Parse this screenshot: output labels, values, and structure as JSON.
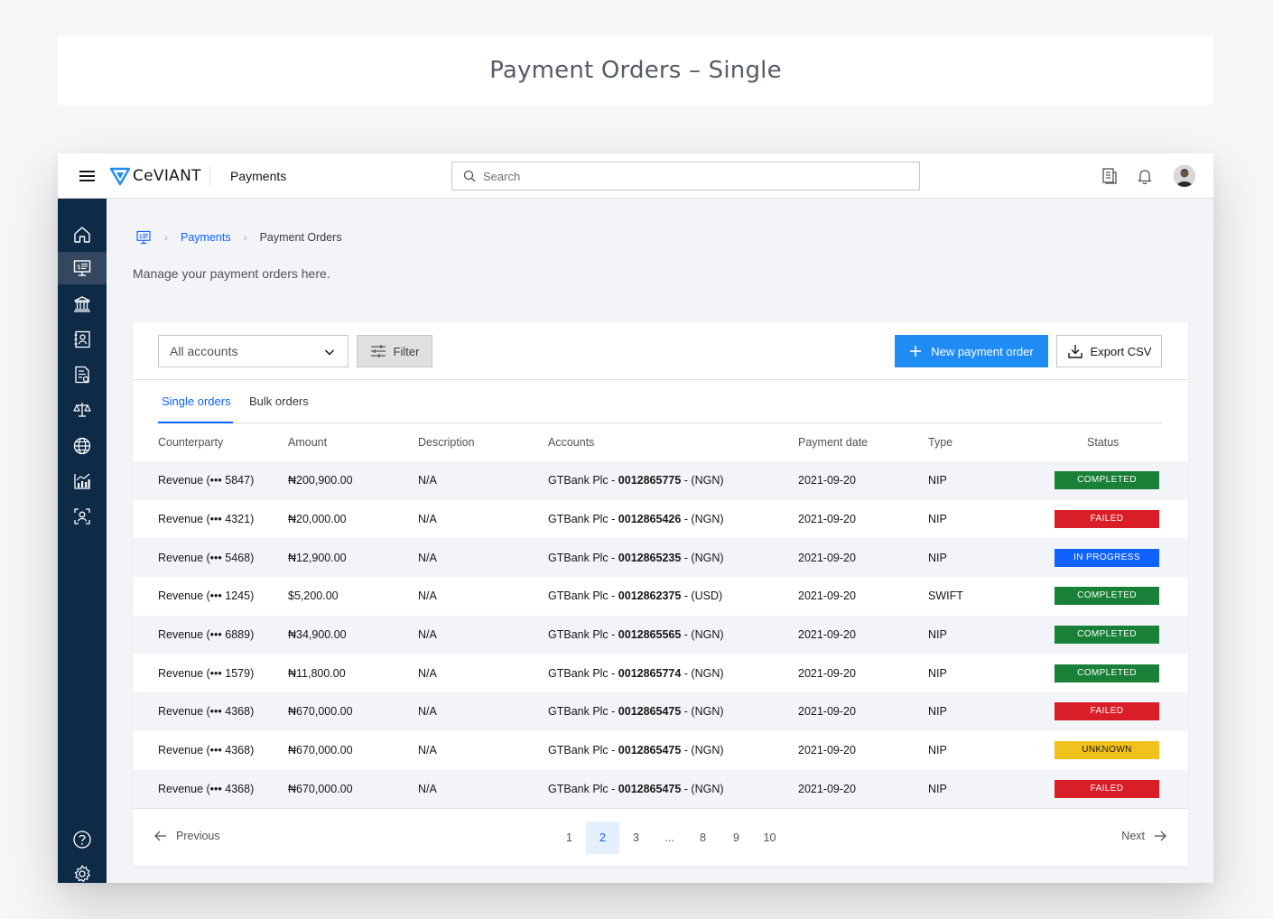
{
  "banner": {
    "title": "Payment Orders – Single"
  },
  "header": {
    "brand": "CeVIANT",
    "section": "Payments",
    "search_placeholder": "Search"
  },
  "sidebar": {
    "items": [
      {
        "icon": "home-icon",
        "active": false
      },
      {
        "icon": "payments-icon",
        "active": true
      },
      {
        "icon": "bank-icon",
        "active": false
      },
      {
        "icon": "contacts-icon",
        "active": false
      },
      {
        "icon": "invoice-icon",
        "active": false
      },
      {
        "icon": "scale-icon",
        "active": false
      },
      {
        "icon": "globe-icon",
        "active": false
      },
      {
        "icon": "analytics-icon",
        "active": false
      },
      {
        "icon": "user-scan-icon",
        "active": false
      }
    ],
    "bottom": [
      "help-icon",
      "settings-icon"
    ]
  },
  "breadcrumb": {
    "link": "Payments",
    "current": "Payment Orders"
  },
  "subtitle": "Manage your payment orders here.",
  "toolbar": {
    "account_select": "All accounts",
    "filter_label": "Filter",
    "new_label": "New payment order",
    "export_label": "Export CSV"
  },
  "tabs": [
    {
      "label": "Single orders",
      "active": true
    },
    {
      "label": "Bulk orders",
      "active": false
    }
  ],
  "table": {
    "columns": [
      "Counterparty",
      "Amount",
      "Description",
      "Accounts",
      "Payment date",
      "Type",
      "Status"
    ],
    "rows": [
      {
        "counterparty": "Revenue (••• 5847)",
        "amount": "₦200,900.00",
        "description": "N/A",
        "bank": "GTBank Plc - ",
        "account": "0012865775",
        "currency": " - (NGN)",
        "date": "2021-09-20",
        "type": "NIP",
        "status": "COMPLETED"
      },
      {
        "counterparty": "Revenue (••• 4321)",
        "amount": "₦20,000.00",
        "description": "N/A",
        "bank": "GTBank Plc - ",
        "account": "0012865426",
        "currency": " - (NGN)",
        "date": "2021-09-20",
        "type": "NIP",
        "status": "FAILED"
      },
      {
        "counterparty": "Revenue (••• 5468)",
        "amount": "₦12,900.00",
        "description": "N/A",
        "bank": "GTBank Plc - ",
        "account": "0012865235",
        "currency": " - (NGN)",
        "date": "2021-09-20",
        "type": "NIP",
        "status": "IN PROGRESS"
      },
      {
        "counterparty": "Revenue (••• 1245)",
        "amount": "$5,200.00",
        "description": "N/A",
        "bank": "GTBank Plc - ",
        "account": "0012862375",
        "currency": " - (USD)",
        "date": "2021-09-20",
        "type": "SWIFT",
        "status": "COMPLETED"
      },
      {
        "counterparty": "Revenue (••• 6889)",
        "amount": "₦34,900.00",
        "description": "N/A",
        "bank": "GTBank Plc - ",
        "account": "0012865565",
        "currency": " - (NGN)",
        "date": "2021-09-20",
        "type": "NIP",
        "status": "COMPLETED"
      },
      {
        "counterparty": "Revenue (••• 1579)",
        "amount": "₦11,800.00",
        "description": "N/A",
        "bank": "GTBank Plc - ",
        "account": "0012865774",
        "currency": " - (NGN)",
        "date": "2021-09-20",
        "type": "NIP",
        "status": "COMPLETED"
      },
      {
        "counterparty": "Revenue (••• 4368)",
        "amount": "₦670,000.00",
        "description": "N/A",
        "bank": "GTBank Plc - ",
        "account": "0012865475",
        "currency": " - (NGN)",
        "date": "2021-09-20",
        "type": "NIP",
        "status": "FAILED"
      },
      {
        "counterparty": "Revenue (••• 4368)",
        "amount": "₦670,000.00",
        "description": "N/A",
        "bank": "GTBank Plc - ",
        "account": "0012865475",
        "currency": " - (NGN)",
        "date": "2021-09-20",
        "type": "NIP",
        "status": "UNKNOWN"
      },
      {
        "counterparty": "Revenue (••• 4368)",
        "amount": "₦670,000.00",
        "description": "N/A",
        "bank": "GTBank Plc - ",
        "account": "0012865475",
        "currency": " - (NGN)",
        "date": "2021-09-20",
        "type": "NIP",
        "status": "FAILED"
      }
    ]
  },
  "pagination": {
    "previous": "Previous",
    "next": "Next",
    "pages": [
      "1",
      "2",
      "3",
      "...",
      "8",
      "9",
      "10"
    ],
    "current": "2"
  },
  "colors": {
    "primary": "#1f8bf5",
    "link": "#0f62fe",
    "sidebar": "#0d2b47",
    "completed": "#198038",
    "failed": "#da1e28",
    "in_progress": "#0f62fe",
    "unknown": "#f1c21b"
  }
}
